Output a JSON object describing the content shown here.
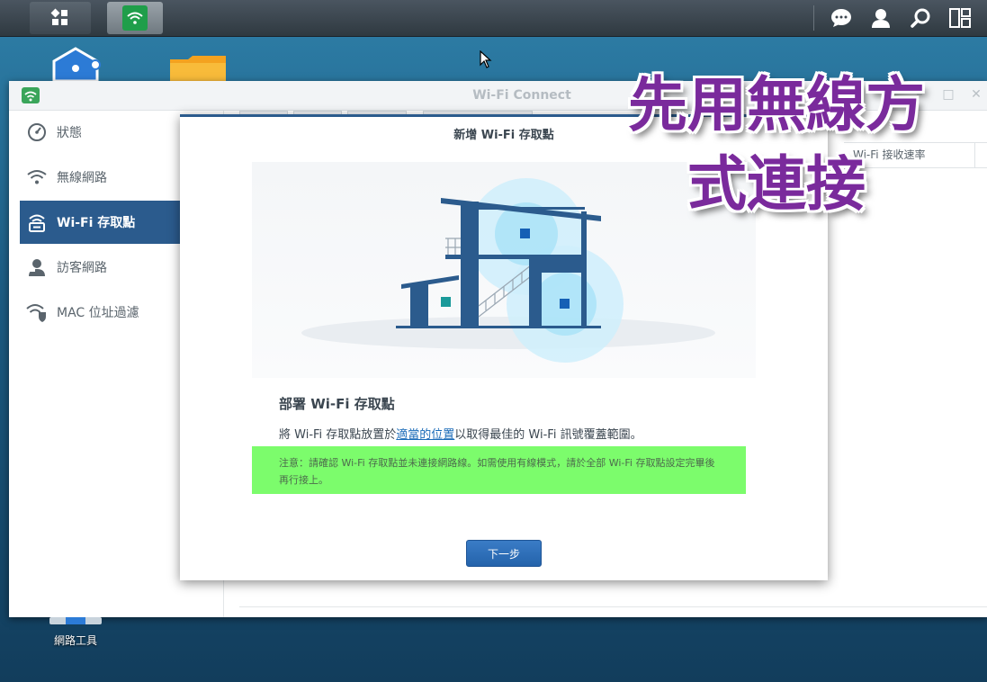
{
  "taskbar": {
    "main_menu_icon": "apps-grid-icon",
    "active_app_icon": "wifi-icon",
    "right_icons": [
      "chat-icon",
      "user-icon",
      "search-icon",
      "widgets-icon"
    ]
  },
  "desktop": {
    "shortcut_label": "網路工具"
  },
  "window": {
    "title": "Wi-Fi Connect",
    "sidebar": {
      "items": [
        {
          "label": "狀態",
          "icon": "gauge-icon"
        },
        {
          "label": "無線網路",
          "icon": "wifi-icon"
        },
        {
          "label": "Wi-Fi 存取點",
          "icon": "access-point-icon",
          "active": true
        },
        {
          "label": "訪客網路",
          "icon": "guest-icon"
        },
        {
          "label": "MAC 位址過濾",
          "icon": "wifi-shield-icon"
        }
      ]
    },
    "table": {
      "header_visible": "Wi-Fi 接收速率"
    }
  },
  "dialog": {
    "title": "新增 Wi-Fi 存取點",
    "section_title": "部署 Wi-Fi 存取點",
    "description_prefix": "將 Wi-Fi 存取點放置於",
    "description_link": "適當的位置",
    "description_suffix": "以取得最佳的 Wi-Fi 訊號覆蓋範圍。",
    "note": "注意：請確認 Wi-Fi 存取點並未連接網路線。如需使用有線模式，請於全部 Wi-Fi 存取點設定完畢後再行接上。",
    "next_button": "下一步"
  },
  "overlay_caption": {
    "line1": "先用無線方",
    "line2": "式連接"
  },
  "colors": {
    "accent": "#2b5b8d",
    "note_highlight": "#7cfc6c",
    "caption": "#7a2a9c"
  }
}
